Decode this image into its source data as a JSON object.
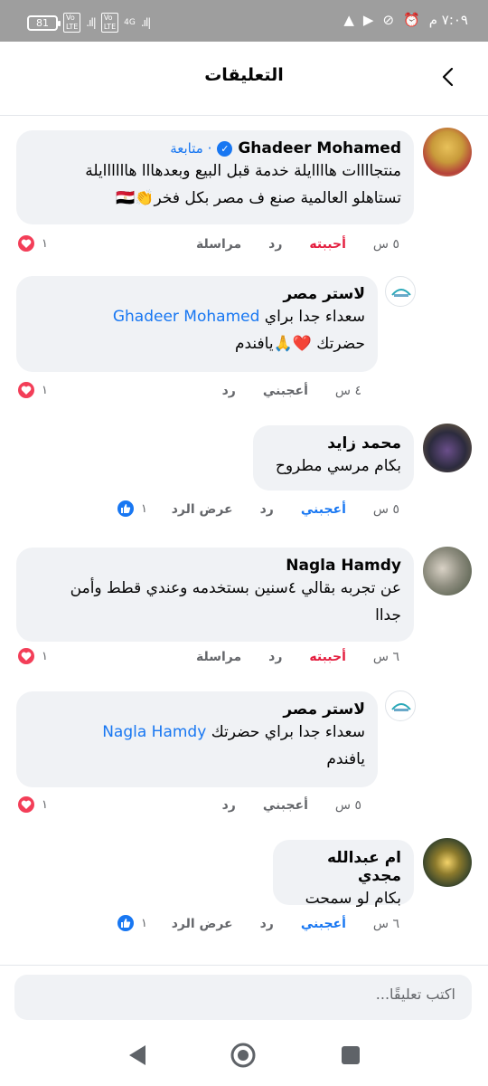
{
  "status_bar": {
    "battery": "81",
    "time": "٧:٠٩ م",
    "network": "4G"
  },
  "header": {
    "title": "التعليقات",
    "back_icon": "chevron-left-icon"
  },
  "comments": [
    {
      "author": "Ghadeer Mohamed",
      "follow": "· متابعة",
      "line1": "منتجاااات هاااايلة خدمة قبل البيع وبعدهااا هاااااايلة",
      "line2": "تستاهلو العالمية صنع ف مصر بكل فخر👏🇪🇬",
      "time": "٥ س",
      "like_label": "أحببته",
      "reply_label": "رد",
      "message_label": "مراسلة",
      "reaction_count": "١"
    },
    {
      "author": "لاستر مصر",
      "mention": "Ghadeer Mohamed",
      "line1_text": "سعداء جدا براي",
      "line2": "حضرتك ❤️🙏يافندم",
      "time": "٤ س",
      "like_label": "أعجبني",
      "reply_label": "رد",
      "reaction_count": "١"
    },
    {
      "author": "محمد زايد",
      "line1": "بكام مرسي مطروح",
      "time": "٥ س",
      "like_label": "أعجبني",
      "reply_label": "رد",
      "view_replies_label": "عرض الرد",
      "reaction_count": "١"
    },
    {
      "author": "Nagla Hamdy",
      "line1": "عن تجربه بقالي ٤سنين بستخدمه وعندي قطط وأمن",
      "line2": "جداا",
      "time": "٦ س",
      "like_label": "أحببته",
      "reply_label": "رد",
      "message_label": "مراسلة",
      "reaction_count": "١"
    },
    {
      "author": "لاستر مصر",
      "mention": "Nagla Hamdy",
      "line1_text": "سعداء جدا براي حضرتك",
      "line2": "يافندم",
      "time": "٥ س",
      "like_label": "أعجبني",
      "reply_label": "رد",
      "reaction_count": "١"
    },
    {
      "author": "ام عبدالله مجدي",
      "line1": "بكام لو سمحت",
      "time": "٦ س",
      "like_label": "أعجبني",
      "reply_label": "رد",
      "view_replies_label": "عرض الرد",
      "reaction_count": "١"
    }
  ],
  "composer": {
    "placeholder": "اكتب تعليقًا..."
  },
  "colors": {
    "accent": "#1877f2",
    "love": "#e41e3f",
    "bubble": "#f0f2f5",
    "statusbar": "#9e9e9e"
  }
}
